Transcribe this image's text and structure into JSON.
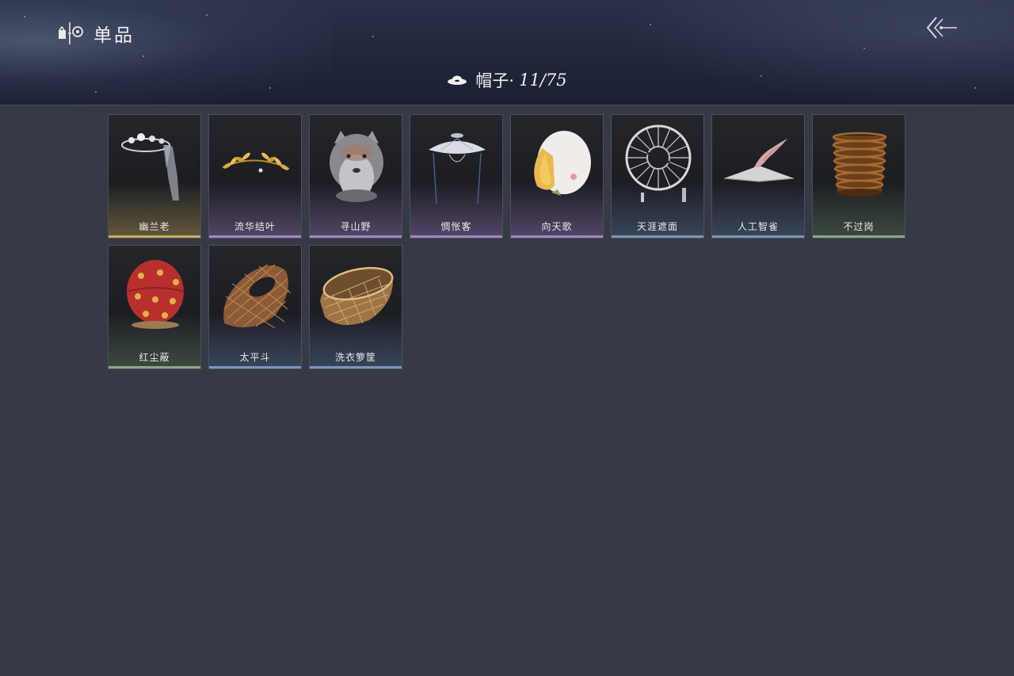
{
  "header": {
    "title": "单品",
    "title_icon": "wardrobe-tag-icon",
    "back_icon": "back-arrow-icon"
  },
  "category": {
    "icon": "hat-icon",
    "label": "帽子·",
    "count": "11/75"
  },
  "colors": {
    "background": "#353a44",
    "header": "#20253a",
    "gold": "#c9ad5f",
    "purple": "#a586c4",
    "blue": "#7c95bd",
    "green": "#8aa58a"
  },
  "items": [
    {
      "name": "幽兰老",
      "icon": "flower-crown-veil-icon",
      "quality": "gold"
    },
    {
      "name": "流华结叶",
      "icon": "golden-laurel-icon",
      "quality": "purple"
    },
    {
      "name": "寻山野",
      "icon": "wolf-head-hat-icon",
      "quality": "purple"
    },
    {
      "name": "惆怅客",
      "icon": "veiled-bamboo-hat-icon",
      "quality": "purple"
    },
    {
      "name": "向天歌",
      "icon": "goose-hood-icon",
      "quality": "purple"
    },
    {
      "name": "天涯遮面",
      "icon": "wheel-frame-hat-icon",
      "quality": "blue"
    },
    {
      "name": "人工智雀",
      "icon": "bird-on-hat-icon",
      "quality": "blue"
    },
    {
      "name": "不过岗",
      "icon": "stacked-bowls-icon",
      "quality": "green"
    },
    {
      "name": "红尘蔽",
      "icon": "red-hood-icon",
      "quality": "green"
    },
    {
      "name": "太平斗",
      "icon": "woven-bamboo-hat-icon",
      "quality": "blue"
    },
    {
      "name": "洗衣箩筐",
      "icon": "wicker-basket-icon",
      "quality": "blue"
    }
  ]
}
